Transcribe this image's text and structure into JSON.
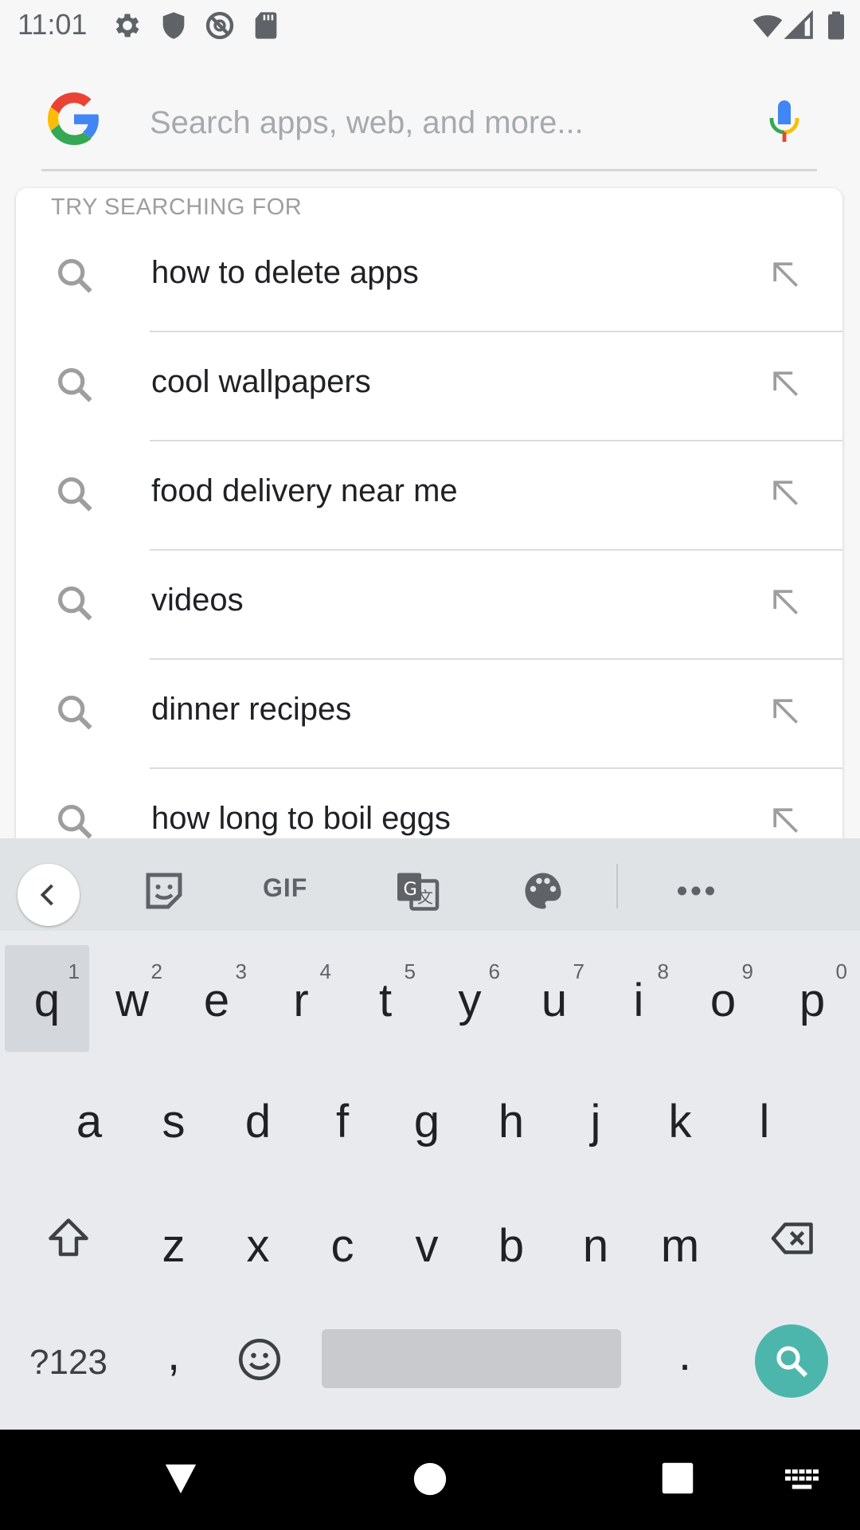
{
  "status_bar": {
    "time": "11:01",
    "left_icons": [
      "gear-icon",
      "shield-icon",
      "no-disturb-icon",
      "sd-card-icon"
    ],
    "right_icons": [
      "wifi-icon",
      "signal-icon",
      "battery-icon"
    ]
  },
  "search": {
    "placeholder": "Search apps, web, and more...",
    "value": "",
    "logo": "google-g-logo",
    "mic_icon": "mic-icon"
  },
  "suggestions": {
    "header": "TRY SEARCHING FOR",
    "items": [
      {
        "label": "how to delete apps"
      },
      {
        "label": "cool wallpapers"
      },
      {
        "label": "food delivery near me"
      },
      {
        "label": "videos"
      },
      {
        "label": "dinner recipes"
      },
      {
        "label": "how long to boil eggs"
      }
    ]
  },
  "keyboard": {
    "toolbar": {
      "gif_label": "GIF",
      "icons": [
        "back-chevron-icon",
        "sticker-icon",
        "gif-icon",
        "translate-icon",
        "palette-icon",
        "more-icon"
      ]
    },
    "row1": [
      {
        "key": "q",
        "num": "1"
      },
      {
        "key": "w",
        "num": "2"
      },
      {
        "key": "e",
        "num": "3"
      },
      {
        "key": "r",
        "num": "4"
      },
      {
        "key": "t",
        "num": "5"
      },
      {
        "key": "y",
        "num": "6"
      },
      {
        "key": "u",
        "num": "7"
      },
      {
        "key": "i",
        "num": "8"
      },
      {
        "key": "o",
        "num": "9"
      },
      {
        "key": "p",
        "num": "0"
      }
    ],
    "row2": [
      "a",
      "s",
      "d",
      "f",
      "g",
      "h",
      "j",
      "k",
      "l"
    ],
    "row3": [
      "z",
      "x",
      "c",
      "v",
      "b",
      "n",
      "m"
    ],
    "row4": {
      "symbols_label": "?123",
      "comma": ",",
      "period": "."
    },
    "pressed_key": "q"
  },
  "nav_bar": {
    "icons": [
      "back-triangle-icon",
      "home-circle-icon",
      "recents-square-icon",
      "keyboard-switch-icon"
    ]
  },
  "colors": {
    "accent_teal": "#4db6ac",
    "google_blue": "#4285f4",
    "google_red": "#ea4335",
    "google_yellow": "#fbbc05",
    "google_green": "#34a853"
  }
}
